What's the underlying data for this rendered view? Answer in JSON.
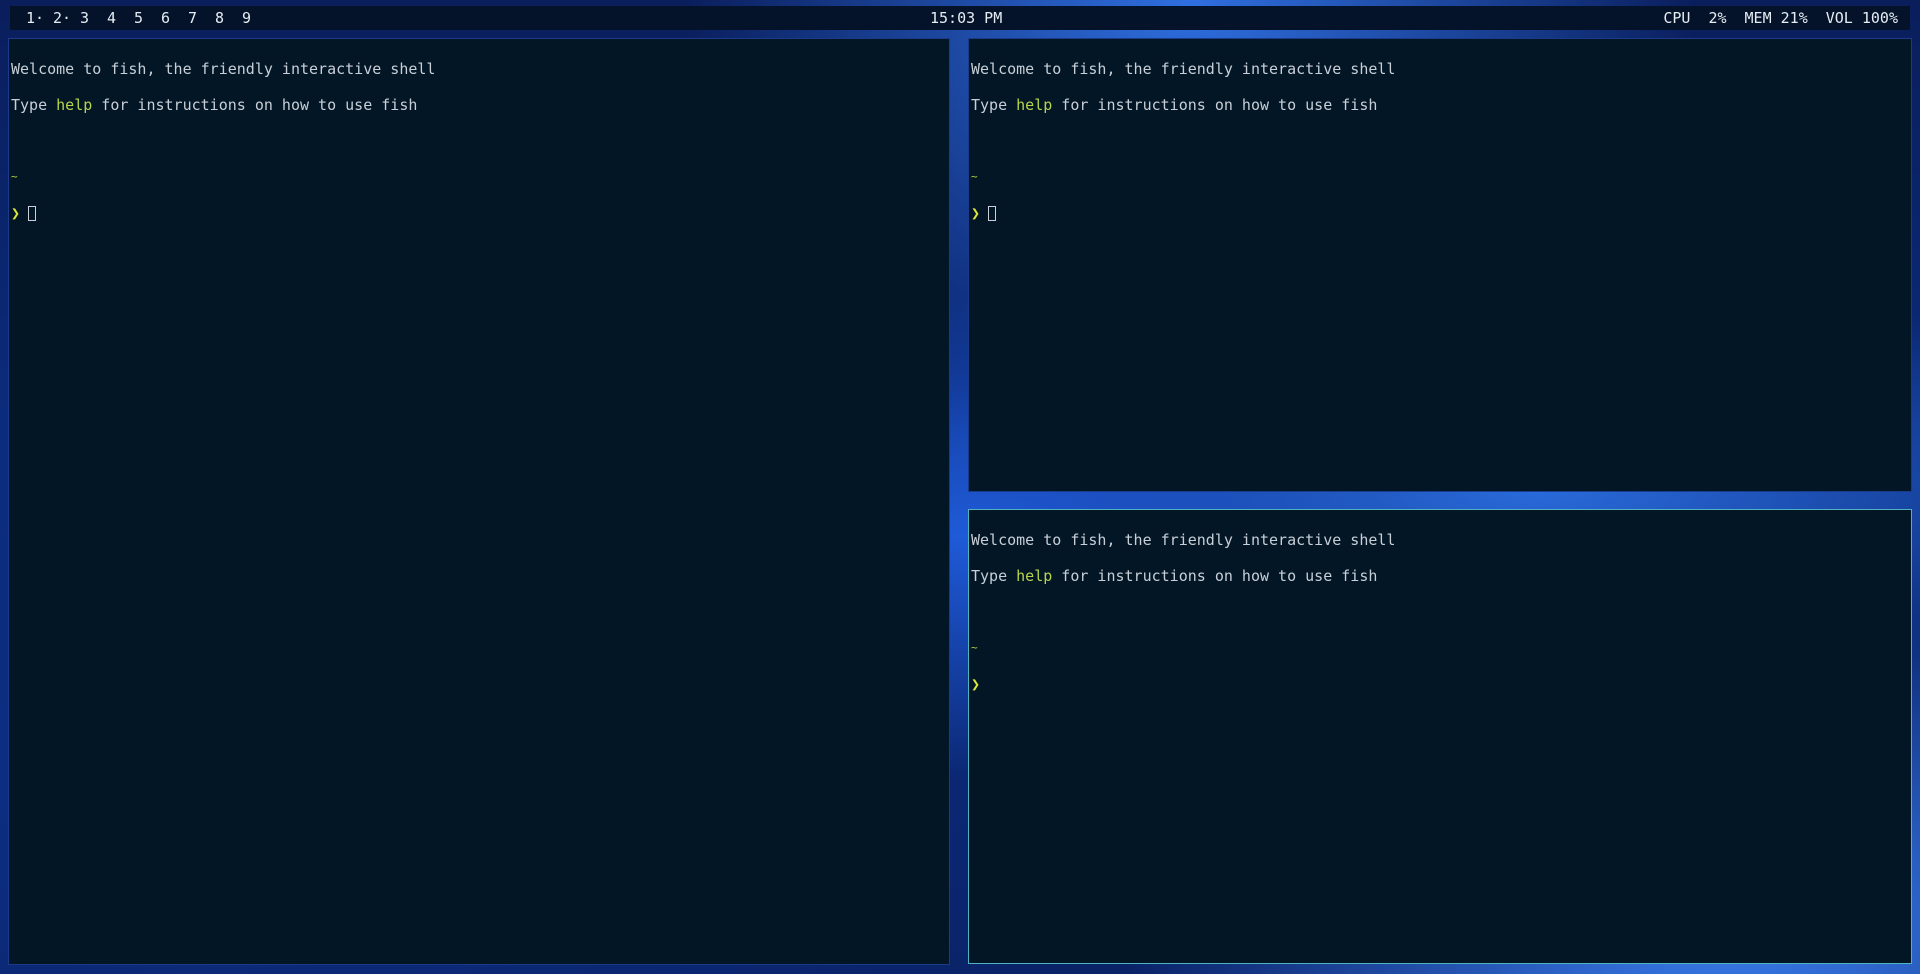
{
  "bar": {
    "workspaces": [
      "1·",
      "2·",
      "3",
      "4",
      "5",
      "6",
      "7",
      "8",
      "9"
    ],
    "clock": "15:03 PM",
    "stats": [
      "CPU  2%",
      "MEM 21%",
      "VOL 100%"
    ]
  },
  "terminal": {
    "welcome": "Welcome to fish, the friendly interactive shell",
    "type_word": "Type ",
    "help_word": "help",
    "instructions": " for instructions on how to use fish",
    "cwd": "~",
    "prompt": "❯"
  },
  "colors": {
    "terminal_bg": "#031626",
    "highlight": "#b8d54a",
    "focused_border": "#4fb3c2",
    "bar_bg": "#04132a"
  }
}
